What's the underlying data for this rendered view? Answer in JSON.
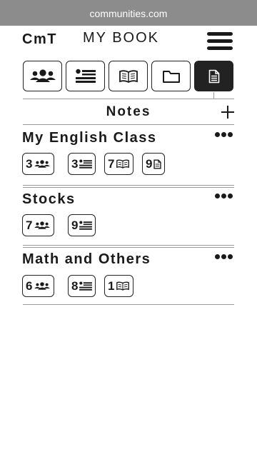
{
  "browser": {
    "url": "communities.com"
  },
  "header": {
    "brand": "CmT",
    "title": "MY BOOK",
    "menu_icon": "hamburger-menu-icon"
  },
  "tabs": [
    {
      "icon": "people-icon",
      "active": false
    },
    {
      "icon": "list-icon",
      "active": false
    },
    {
      "icon": "book-icon",
      "active": false
    },
    {
      "icon": "folder-icon",
      "active": false
    },
    {
      "icon": "note-icon",
      "active": true
    }
  ],
  "section": {
    "title": "Notes",
    "add_icon": "plus-icon"
  },
  "groups": [
    {
      "name": "My English Class",
      "chips": [
        {
          "count": "3",
          "icon": "people-icon"
        },
        {
          "count": "3",
          "icon": "list-icon"
        },
        {
          "count": "7",
          "icon": "book-icon"
        },
        {
          "count": "9",
          "icon": "note-icon"
        }
      ]
    },
    {
      "name": "Stocks",
      "chips": [
        {
          "count": "7",
          "icon": "people-icon"
        },
        {
          "count": "9",
          "icon": "list-icon"
        }
      ]
    },
    {
      "name": "Math and Others",
      "chips": [
        {
          "count": "6",
          "icon": "people-icon"
        },
        {
          "count": "8",
          "icon": "list-icon"
        },
        {
          "count": "1",
          "icon": "book-icon"
        }
      ]
    }
  ],
  "colors": {
    "url_bar": "#8c8c8c",
    "ink": "#1a1a1a",
    "active_tab": "#222222",
    "rule": "#9a9a9a"
  }
}
